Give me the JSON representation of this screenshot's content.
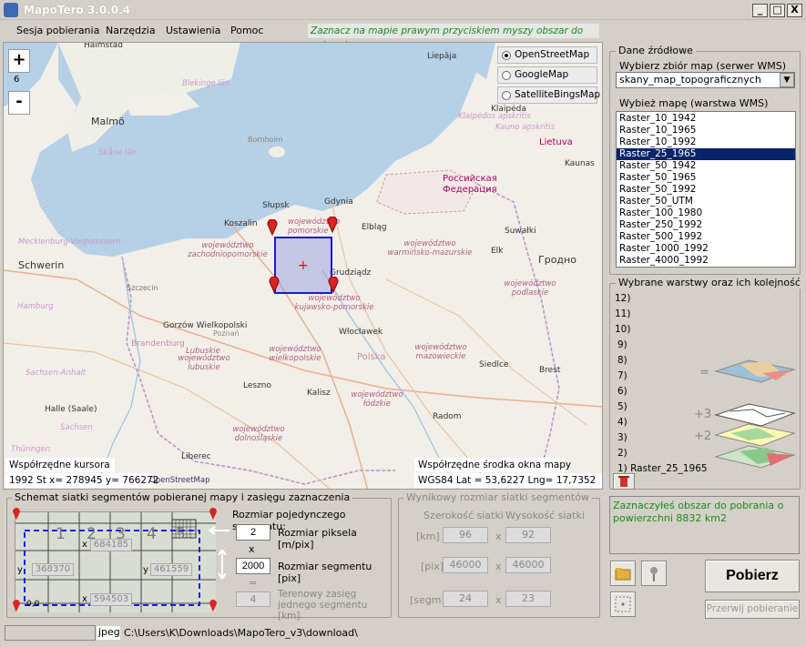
{
  "window": {
    "title": "MapoTero 3.0.0.4",
    "min": "_",
    "max": "□",
    "close": "X"
  },
  "menu": {
    "items": [
      "Sesja pobierania",
      "Narzędzia",
      "Ustawienia",
      "Pomoc"
    ],
    "hint": "Zaznacz na mapie  prawym  przyciskiem myszy obszar do pobrania"
  },
  "map": {
    "zoom_in": "+",
    "zoom_level": "6",
    "zoom_out": "-",
    "sources": [
      {
        "label": "OpenStreetMap",
        "selected": true
      },
      {
        "label": "GoogleMap",
        "selected": false
      },
      {
        "label": "SatelliteBingsMap",
        "selected": false
      }
    ],
    "cities": [
      "Halmstad",
      "Malmö",
      "Liepāja",
      "Klaipėda",
      "Kaunas",
      "Lietuva",
      "Słupsk",
      "Gdynia",
      "Koszalin",
      "Elbląg",
      "Suwałki",
      "Elk",
      "Grudziądz",
      "Gorzów Wielkopolski",
      "Włocławek",
      "Szczecin",
      "Schwerin",
      "Siedlce",
      "Poznań",
      "Leszno",
      "Kalisz",
      "Radom",
      "Liberec",
      "Halle (Saale)",
      "Brandenburg",
      "Brest",
      "Гродно",
      "Российская Федерация",
      "Bornholm",
      "Lubuskie",
      "Blekinge län",
      "Skåne län",
      "Klaipėdos apskritis",
      "Kauno apskritis",
      "Hamburg",
      "Polska",
      "Mecklenburg-Vorpommern",
      "Sachsen-Anhalt",
      "Sachsen",
      "Thüringen"
    ],
    "regions": [
      "województwo pomorskie",
      "województwo zachodniopomorskie",
      "województwo warmińsko-mazurskie",
      "województwo podlaskie",
      "województwo kujawsko-pomorskie",
      "województwo wielkopolskie",
      "województwo lubuskie",
      "województwo mazowieckie",
      "województwo łódzkie",
      "województwo dolnośląskie"
    ],
    "cursor_label": "Współrzędne kursora",
    "cursor_values": "1992  St x= 278945   y= 766272",
    "osm_credit": "OpenStreetMap",
    "center_label": "Współrzędne środka okna mapy",
    "center_values": "WGS84  Lat = 53,6227    Lng=  17,7352"
  },
  "source_panel": {
    "legend": "Dane źródłowe",
    "set_label": "Wybierz zbiór map (serwer WMS)",
    "set_value": "skany_map_topograficznych",
    "layer_label": "Wybież mapę (warstwa WMS)",
    "layers": [
      "Raster_10_1942",
      "Raster_10_1965",
      "Raster_10_1992",
      "Raster_25_1965",
      "Raster_50_1942",
      "Raster_50_1965",
      "Raster_50_1992",
      "Raster_50_UTM",
      "Raster_100_1980",
      "Raster_250_1992",
      "Raster_500_1992",
      "Raster_1000_1992",
      "Raster_4000_1992"
    ],
    "selected_index": 3
  },
  "layers_panel": {
    "legend": "Wybrane warstwy oraz ich kolejność",
    "slots": [
      "12)",
      "11)",
      "10)",
      "9)",
      "8)",
      "7)",
      "6)",
      "5)",
      "4)",
      "3)",
      "2)",
      "1) Raster_25_1965"
    ],
    "eq": "=",
    "plus3": "+3",
    "plus2": "+2"
  },
  "grid_panel": {
    "legend": "Schemat siatki segmentów pobieranej mapy i zasięgu zaznaczenia",
    "nums": [
      "1",
      "2",
      "3",
      "4",
      "5"
    ],
    "x_top": "684185",
    "x_bot": "594503",
    "y_left": "368370",
    "y_right": "461559",
    "x_label": "x",
    "y_label": "y",
    "origin": "0,0",
    "seg_title": "Rozmiar pojedynczego segmentu:",
    "pix_value": "2",
    "pix_label": "Rozmiar piksela [m/pix]",
    "times": "x",
    "seg_value": "2000",
    "seg_label": "Rozmiar segmentu [pix]",
    "eq": "=",
    "range_value": "4",
    "range_label": "Terenowy zasięg jednego segmentu [km]"
  },
  "result_panel": {
    "legend": "Wynikowy rozmiar siatki segmentów",
    "w_label": "Szerokość siatki",
    "h_label": "Wysokość siatki",
    "rows": [
      {
        "unit": "[km]",
        "w": "96",
        "h": "92"
      },
      {
        "unit": "[pix]",
        "w": "46000",
        "h": "46000"
      },
      {
        "unit": "[segm]",
        "w": "24",
        "h": "23"
      }
    ],
    "x": "x"
  },
  "info": {
    "message": "Zaznaczyłeś obszar do pobrania o powierzchni 8832 km2"
  },
  "actions": {
    "download": "Pobierz",
    "abort": "Przerwij pobieranie"
  },
  "status": {
    "format": "jpeg",
    "path": "C:\\Users\\K\\Downloads\\MapoTero_v3\\download\\"
  },
  "colors": {
    "selection": "#0a246a",
    "hint": "#1a8a1a",
    "region": "#b06080",
    "info": "#1a8a1a"
  }
}
